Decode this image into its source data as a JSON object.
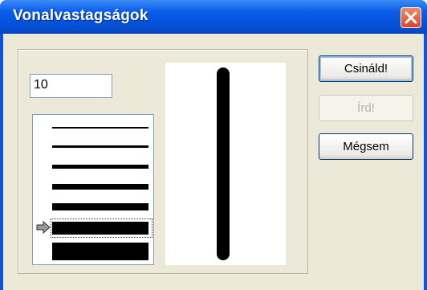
{
  "window": {
    "title": "Vonalvastagságok"
  },
  "input": {
    "value": "10"
  },
  "buttons": {
    "ok": "Csináld!",
    "apply": "Írd!",
    "cancel": "Mégsem"
  },
  "line_widths": {
    "selected_index": 5
  },
  "preview": {
    "selected_thickness": 10
  },
  "colors": {
    "titlebar": "#0a5cea",
    "dialog_bg": "#ece9d8",
    "close": "#d8452a"
  }
}
